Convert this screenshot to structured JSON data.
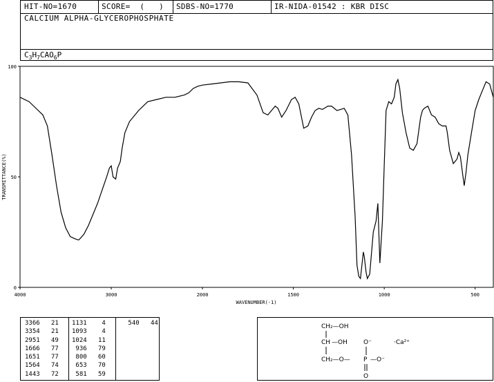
{
  "header": {
    "hit_no": "HIT-NO=1670",
    "score": "SCORE=  (   )",
    "sdbs_no": "SDBS-NO=1770",
    "ir_info": "IR-NIDA-01542 : KBR DISC",
    "compound_name": "CALCIUM ALPHA-GLYCEROPHOSPHATE",
    "formula": {
      "c": "C",
      "c_n": "3",
      "h": "H",
      "h_n": "7",
      "ca_o": "CAO",
      "o_n": "6",
      "p": "P"
    }
  },
  "chart_data": {
    "type": "line",
    "xlabel": "WAVENUMBER(-1)",
    "ylabel": "TRANSMITTANCE(%)",
    "xlim": [
      4000,
      400
    ],
    "ylim": [
      0,
      100
    ],
    "x_ticks": [
      "4000",
      "3000",
      "2000",
      "1500",
      "1000",
      "500"
    ],
    "y_ticks": [
      "100",
      "50",
      "0"
    ],
    "grid": false,
    "series": [
      {
        "x": [
          4000,
          3900,
          3800,
          3750,
          3700,
          3650,
          3600,
          3550,
          3500,
          3450,
          3400,
          3366,
          3354,
          3300,
          3250,
          3200,
          3150,
          3100,
          3050,
          3020,
          3000,
          2980,
          2951,
          2930,
          2920,
          2900,
          2880,
          2850,
          2800,
          2700,
          2600,
          2500,
          2400,
          2300,
          2200,
          2150,
          2100,
          2050,
          2000,
          1950,
          1900,
          1850,
          1800,
          1750,
          1700,
          1666,
          1640,
          1620,
          1600,
          1585,
          1564,
          1540,
          1510,
          1490,
          1470,
          1443,
          1420,
          1400,
          1380,
          1360,
          1340,
          1310,
          1290,
          1260,
          1240,
          1220,
          1200,
          1180,
          1160,
          1150,
          1140,
          1131,
          1120,
          1115,
          1110,
          1100,
          1093,
          1080,
          1060,
          1045,
          1035,
          1024,
          1010,
          1000,
          990,
          975,
          960,
          945,
          936,
          925,
          915,
          900,
          880,
          860,
          840,
          820,
          800,
          790,
          780,
          760,
          740,
          720,
          700,
          680,
          660,
          653,
          640,
          620,
          600,
          590,
          581,
          570,
          560,
          550,
          540,
          520,
          500,
          480,
          460,
          440,
          420,
          400
        ],
        "y": [
          86,
          84,
          80,
          78,
          73,
          60,
          46,
          34,
          27,
          23,
          22,
          21.5,
          21.5,
          24,
          28,
          33,
          38,
          44,
          50,
          54,
          55,
          50,
          49,
          54,
          55,
          57,
          63,
          70,
          75,
          80,
          84,
          85,
          86,
          86,
          87,
          88,
          90,
          91,
          91.5,
          92,
          92.5,
          93,
          93,
          92.5,
          87,
          79,
          78,
          80,
          82,
          81,
          77,
          80,
          85,
          86,
          83,
          72,
          73,
          77,
          80,
          81,
          80.5,
          82,
          82,
          80,
          80.5,
          81,
          78,
          60,
          32,
          10,
          5,
          4,
          12,
          16,
          14,
          7,
          4,
          6,
          25,
          30,
          38,
          11,
          30,
          55,
          80,
          84,
          83,
          86,
          92,
          94,
          90,
          79,
          70,
          63,
          62,
          65,
          77,
          80,
          81,
          82,
          78,
          77,
          74,
          73,
          73,
          70,
          62,
          56,
          58,
          61,
          59,
          52,
          46,
          52,
          60,
          70,
          80,
          85,
          89,
          93,
          92,
          86
        ]
      }
    ]
  },
  "peak_table": {
    "col1": [
      {
        "wn": "3366",
        "t": "21"
      },
      {
        "wn": "3354",
        "t": "21"
      },
      {
        "wn": "2951",
        "t": "49"
      },
      {
        "wn": "1666",
        "t": "77"
      },
      {
        "wn": "1651",
        "t": "77"
      },
      {
        "wn": "1564",
        "t": "74"
      },
      {
        "wn": "1443",
        "t": "72"
      }
    ],
    "col2": [
      {
        "wn": "1131",
        "t": "4"
      },
      {
        "wn": "1093",
        "t": "4"
      },
      {
        "wn": "1024",
        "t": "11"
      },
      {
        "wn": "936",
        "t": "79"
      },
      {
        "wn": "800",
        "t": "60"
      },
      {
        "wn": "653",
        "t": "70"
      },
      {
        "wn": "581",
        "t": "59"
      }
    ],
    "col3": [
      {
        "wn": "540",
        "t": "44"
      }
    ]
  },
  "structure": {
    "ch2_top": "CH₂—OH",
    "ch_mid": "CH",
    "oh_mid": "—OH",
    "o_minus_top": "O⁻",
    "ch2_bottom": "CH₂—O—",
    "p": "P",
    "o_minus_right": "—O⁻",
    "o_bottom": "O",
    "ca": "·Ca²⁺"
  }
}
